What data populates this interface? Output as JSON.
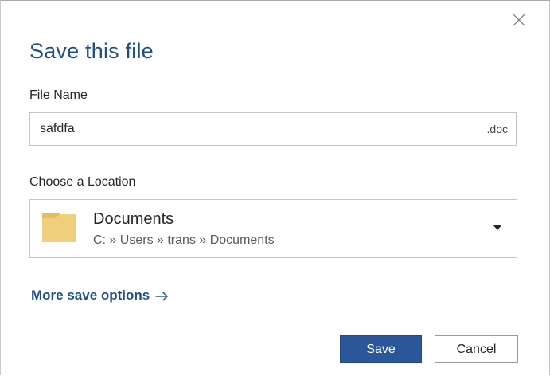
{
  "dialog": {
    "title": "Save this file",
    "close_icon": "close-icon"
  },
  "file_name": {
    "label": "File Name",
    "value": "safdfa",
    "extension": ".doc"
  },
  "location": {
    "label": "Choose a Location",
    "icon": "folder-icon",
    "name": "Documents",
    "path": "C: » Users » trans » Documents",
    "dropdown_icon": "caret-down-icon"
  },
  "more_options": {
    "label": "More save options",
    "icon": "arrow-right-icon"
  },
  "buttons": {
    "save_accel": "S",
    "save_rest": "ave",
    "cancel": "Cancel"
  },
  "colors": {
    "accent": "#1e4e8c",
    "primary_button": "#2b579a",
    "folder": "#f0cf7c"
  }
}
